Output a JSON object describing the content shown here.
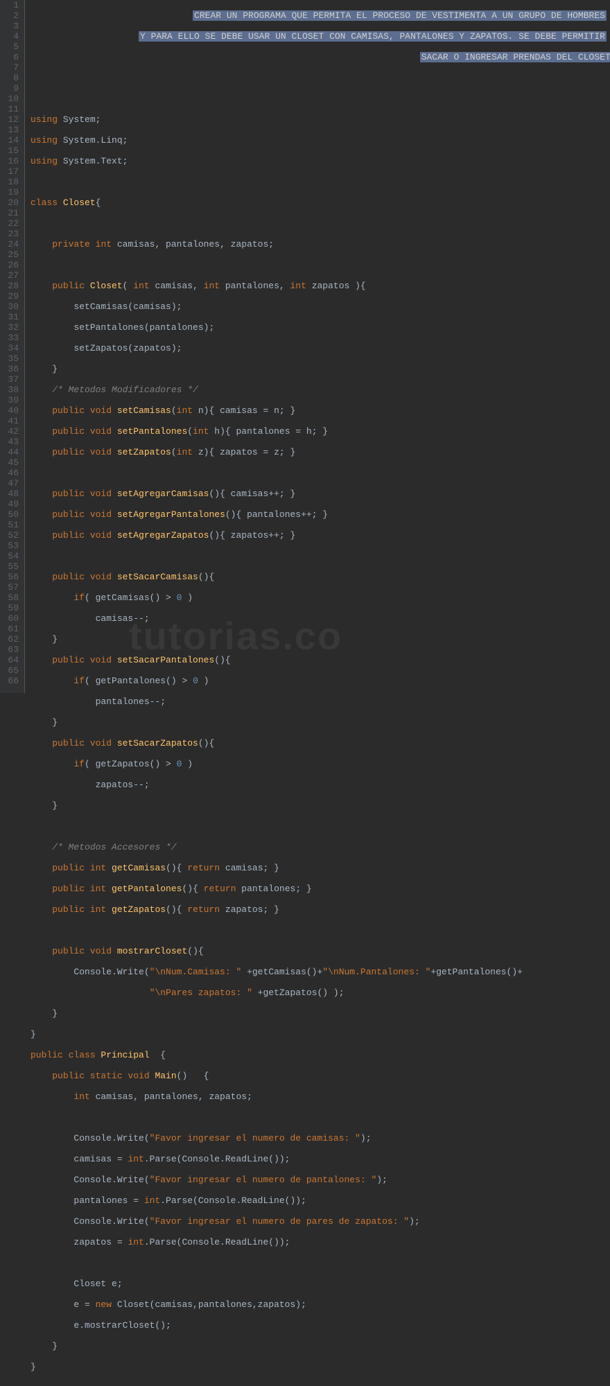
{
  "watermark": "tutorias.co",
  "gutter": {
    "start": 1,
    "end": 66
  },
  "header_comment": [
    "CREAR UN PROGRAMA QUE PERMITA EL PROCESO DE VESTIMENTA A UN GRUPO DE HOMBRES",
    "Y PARA ELLO SE DEBE USAR UN CLOSET CON CAMISAS, PANTALONES Y ZAPATOS. SE DEBE PERMITIR",
    "SACAR O INGRESAR PRENDAS DEL CLOSET"
  ],
  "code": {
    "using1": "using",
    "ns1": " System;",
    "using2": "using",
    "ns2": " System.Linq;",
    "using3": "using",
    "ns3": " System.Text;",
    "class_kw": "class",
    "class_name": " Closet",
    "ob": "{",
    "priv": "private ",
    "int": "int",
    "fields": " camisas, pantalones, zapatos;",
    "pub": "public ",
    "ctor": "Closet",
    "ctor_sig_a": "( ",
    "ctor_sig_b": " camisas, ",
    "ctor_sig_c": " pantalones, ",
    "ctor_sig_d": " zapatos ){",
    "setC": "        setCamisas(camisas);",
    "setP": "        setPantalones(pantalones);",
    "setZ": "        setZapatos(zapatos);",
    "cb": "    }",
    "cmt_mod": "/* Metodos Modificadores */",
    "void": "void ",
    "fn_setCamisas": "setCamisas",
    "sig_n": "(",
    "param_n": " n){ camisas = n; }",
    "fn_setPantalones": "setPantalones",
    "param_h": " h){ pantalones = h; }",
    "fn_setZapatos": "setZapatos",
    "param_z": " z){ zapatos = z; }",
    "fn_agC": "setAgregarCamisas",
    "agC_body": "(){ camisas++; }",
    "fn_agP": "setAgregarPantalones",
    "agP_body": "(){ pantalones++; }",
    "fn_agZ": "setAgregarZapatos",
    "agZ_body": "(){ zapatos++; }",
    "fn_saC": "setSacarCamisas",
    "saC_sig": "(){",
    "if": "if",
    "saC_cond": "( getCamisas() > ",
    "zero": "0",
    "cond_end": " )",
    "saC_body": "            camisas--;",
    "fn_saP": "setSacarPantalones",
    "saP_sig": "(){",
    "saP_cond": "( getPantalones() > ",
    "saP_body": "            pantalones--;",
    "fn_saZ": "setSacarZapatos",
    "saZ_sig": "(){",
    "saZ_cond": "( getZapatos() > ",
    "saZ_body": "            zapatos--;",
    "cmt_acc": "/* Metodos Accesores */",
    "ret": "return",
    "fn_getC": "getCamisas",
    "getC_body": "(){ ",
    "getC_ret": " camisas; }",
    "fn_getP": "getPantalones",
    "getP_body": "(){ ",
    "getP_ret": " pantalones; }",
    "fn_getZ": "getZapatos",
    "getZ_body": "(){ ",
    "getZ_ret": " zapatos; }",
    "fn_mostrar": "mostrarCloset",
    "mostrar_sig": "(){",
    "cwrite": "        Console.Write(",
    "str1": "\"\\nNum.Camisas: \"",
    "plus1": " +getCamisas()+",
    "str2": "\"\\nNum.Pantalones: \"",
    "plus2": "+getPantalones()+",
    "str3": "\"\\nPares zapatos: \"",
    "plus3": " +getZapatos() );",
    "cb2": "}",
    "class2_kw": "public class ",
    "class2_name": "Principal",
    "class2_ob": "  {",
    "static": "static ",
    "main": "Main",
    "main_sig": "()   {",
    "main_vars": " camisas, pantalones, zapatos;",
    "prompt1": "\"Favor ingresar el numero de camisas: \"",
    "end_paren": ");",
    "parse1a": "        camisas = ",
    "parse_int": "int",
    "parse1b": ".Parse(Console.ReadLine());",
    "prompt2": "\"Favor ingresar el numero de pantalones: \"",
    "parse2a": "        pantalones = ",
    "parse2b": ".Parse(Console.ReadLine());",
    "prompt3": "\"Favor ingresar el numero de pares de zapatos: \"",
    "parse3a": "        zapatos = ",
    "parse3b": ".Parse(Console.ReadLine());",
    "decl_e": "        Closet e;",
    "new_e": "        e = ",
    "new_kw": "new",
    "new_call": " Closet(camisas,pantalones,zapatos);",
    "call_mostrar": "        e.mostrarCloset();",
    "cb3": "    }",
    "cb4": "}"
  }
}
